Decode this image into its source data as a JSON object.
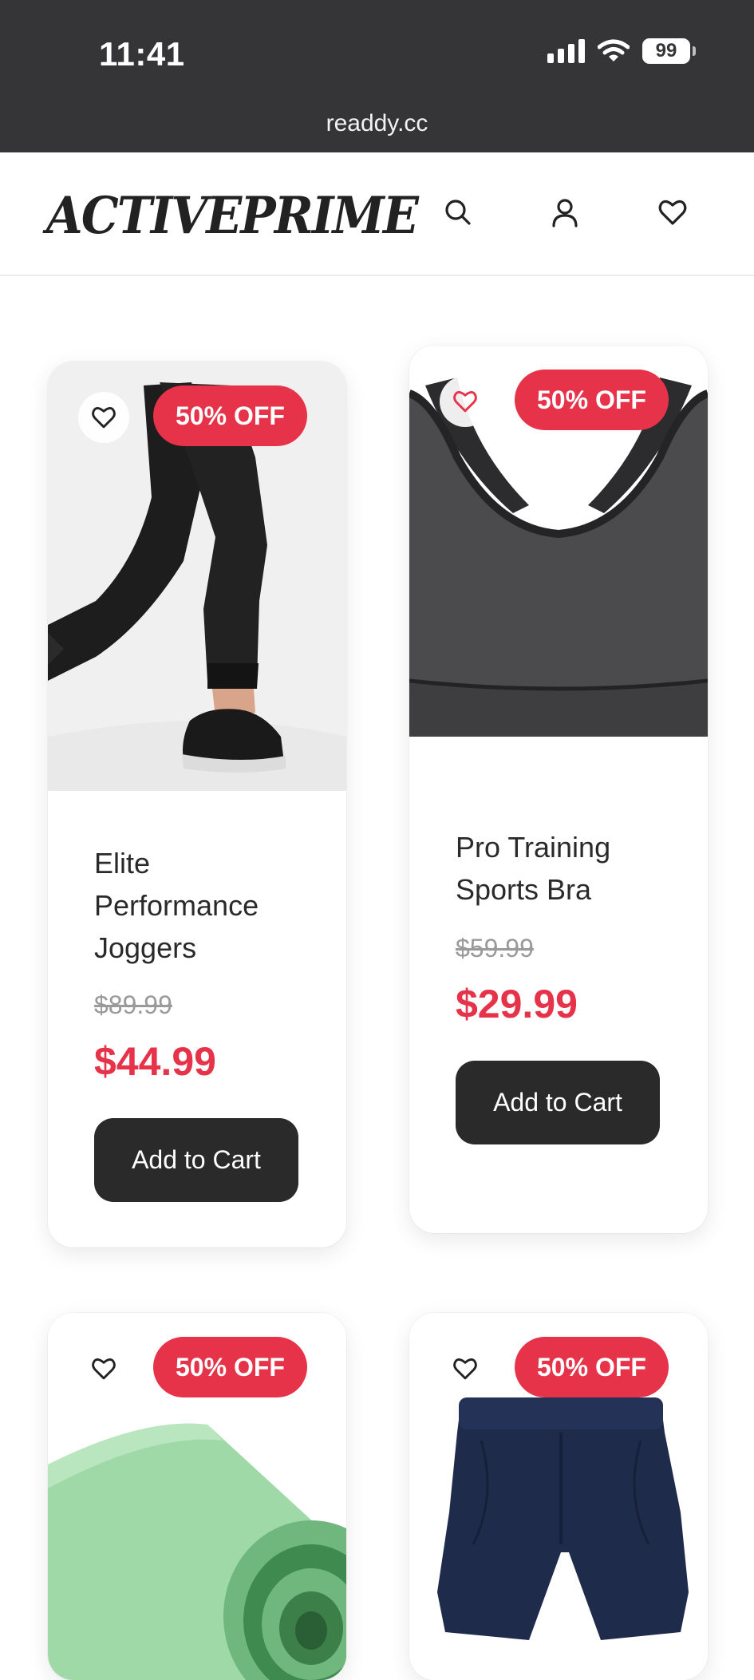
{
  "status_bar": {
    "time": "11:41",
    "battery": "99",
    "url": "readdy.cc",
    "icons": [
      "signal-icon",
      "wifi-icon",
      "battery-icon"
    ]
  },
  "header": {
    "logo": "ACTIVEPRIME",
    "icons": [
      "search-icon",
      "user-icon",
      "heart-icon"
    ]
  },
  "colors": {
    "accent": "#e63349",
    "button": "#2a2a2a",
    "status_bar": "#353538"
  },
  "products": [
    {
      "name": "Elite Performance Joggers",
      "badge": "50% OFF",
      "old_price": "$89.99",
      "price": "$44.99",
      "button": "Add to Cart",
      "favorited": false
    },
    {
      "name": "Pro Training Sports Bra",
      "badge": "50% OFF",
      "old_price": "$59.99",
      "price": "$29.99",
      "button": "Add to Cart",
      "favorited": true
    },
    {
      "badge": "50% OFF",
      "favorited": false
    },
    {
      "badge": "50% OFF",
      "favorited": false
    }
  ]
}
